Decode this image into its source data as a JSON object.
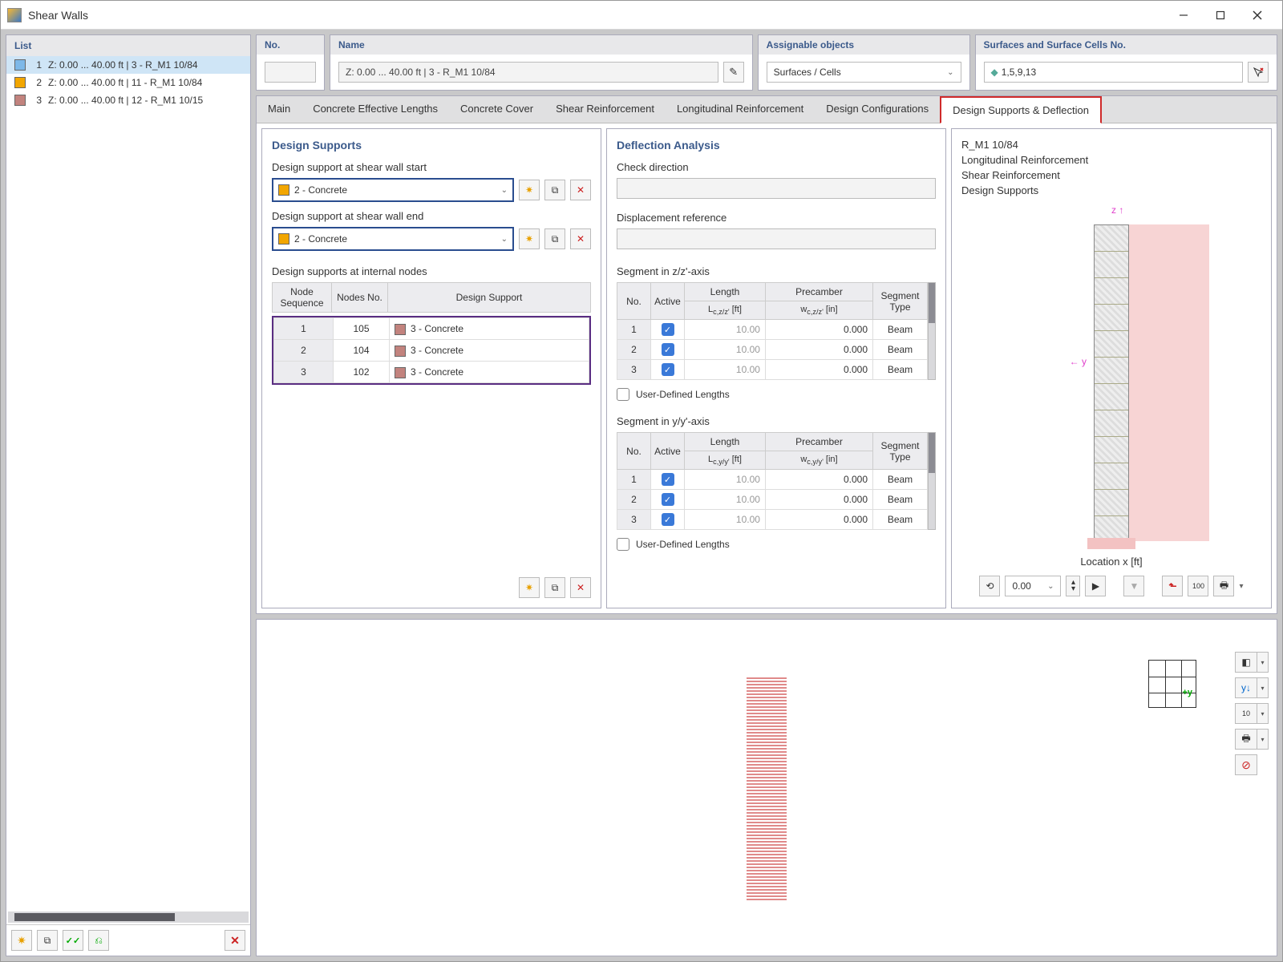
{
  "window_title": "Shear Walls",
  "list_header": "List",
  "list_items": [
    {
      "idx": "1",
      "color": "#7db8e8",
      "label": "Z: 0.00 ... 40.00 ft | 3 - R_M1 10/84",
      "selected": true
    },
    {
      "idx": "2",
      "color": "#f2a600",
      "label": "Z: 0.00 ... 40.00 ft | 11 - R_M1 10/84",
      "selected": false
    },
    {
      "idx": "3",
      "color": "#c2837e",
      "label": "Z: 0.00 ... 40.00 ft | 12 - R_M1 10/15",
      "selected": false
    }
  ],
  "no_label": "No.",
  "name_label": "Name",
  "name_value": "Z: 0.00 ... 40.00  ft | 3 - R_M1 10/84",
  "assignable_label": "Assignable objects",
  "assignable_value": "Surfaces / Cells",
  "surfaces_label": "Surfaces and Surface Cells No.",
  "surfaces_value": "1,5,9,13",
  "tabs": [
    "Main",
    "Concrete Effective Lengths",
    "Concrete Cover",
    "Shear Reinforcement",
    "Longitudinal Reinforcement",
    "Design Configurations",
    "Design Supports & Deflection"
  ],
  "active_tab": 6,
  "design_supports": {
    "title": "Design Supports",
    "start_label": "Design support at shear wall start",
    "start_value": "2 - Concrete",
    "end_label": "Design support at shear wall end",
    "end_value": "2 - Concrete",
    "internal_label": "Design supports at internal nodes",
    "table_headers": [
      "Node Sequence",
      "Nodes No.",
      "Design Support"
    ],
    "rows": [
      {
        "seq": "1",
        "node": "105",
        "support": "3 - Concrete",
        "color": "#c2837e"
      },
      {
        "seq": "2",
        "node": "104",
        "support": "3 - Concrete",
        "color": "#c2837e"
      },
      {
        "seq": "3",
        "node": "102",
        "support": "3 - Concrete",
        "color": "#c2837e"
      }
    ]
  },
  "deflection": {
    "title": "Deflection Analysis",
    "check_dir": "Check direction",
    "disp_ref": "Displacement reference",
    "seg_z_label": "Segment in z/z'-axis",
    "seg_y_label": "Segment in y/y'-axis",
    "headers": {
      "no": "No.",
      "active": "Active",
      "len_z": "Length L<sub>c,z/z'</sub> [ft]",
      "pre_z": "Precamber w<sub>c,z/z'</sub> [in]",
      "len_y": "Length L<sub>c,y/y'</sub> [ft]",
      "pre_y": "Precamber w<sub>c,y/y'</sub> [in]",
      "type": "Segment Type"
    },
    "z_rows": [
      {
        "no": "1",
        "active": true,
        "len": "10.00",
        "pre": "0.000",
        "type": "Beam"
      },
      {
        "no": "2",
        "active": true,
        "len": "10.00",
        "pre": "0.000",
        "type": "Beam"
      },
      {
        "no": "3",
        "active": true,
        "len": "10.00",
        "pre": "0.000",
        "type": "Beam"
      }
    ],
    "y_rows": [
      {
        "no": "1",
        "active": true,
        "len": "10.00",
        "pre": "0.000",
        "type": "Beam"
      },
      {
        "no": "2",
        "active": true,
        "len": "10.00",
        "pre": "0.000",
        "type": "Beam"
      },
      {
        "no": "3",
        "active": true,
        "len": "10.00",
        "pre": "0.000",
        "type": "Beam"
      }
    ],
    "udl": "User-Defined Lengths"
  },
  "preview": {
    "lines": [
      "R_M1 10/84",
      "Longitudinal Reinforcement",
      "Shear Reinforcement",
      "Design Supports"
    ],
    "axis_z": "z",
    "axis_y": "y",
    "loc_label": "Location x [ft]",
    "loc_value": "0.00"
  },
  "view_cube_y": "+y"
}
